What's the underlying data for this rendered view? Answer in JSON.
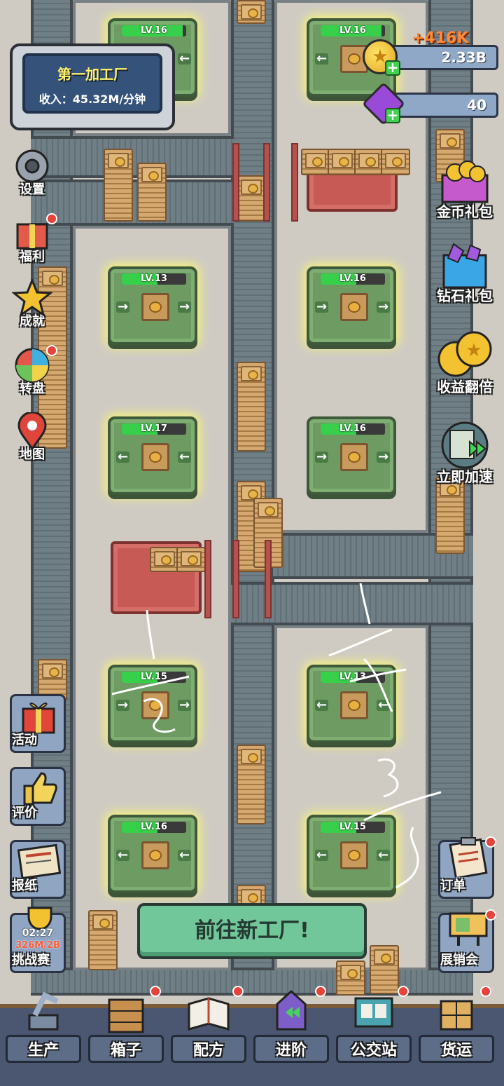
{
  "factory": {
    "name": "第一加工厂",
    "income": "收入：45.32M/分钟"
  },
  "currency": {
    "coins": "2.33B",
    "coin_gain": "+416K",
    "gems": "40"
  },
  "left_menu": [
    {
      "label": "设置",
      "icon": "gear-icon"
    },
    {
      "label": "福利",
      "icon": "gift-icon"
    },
    {
      "label": "成就",
      "icon": "star-badge-icon"
    },
    {
      "label": "转盘",
      "icon": "wheel-icon"
    },
    {
      "label": "地图",
      "icon": "map-pin-icon"
    }
  ],
  "right_menu": [
    {
      "label": "金币礼包",
      "icon": "coin-chest-icon"
    },
    {
      "label": "钻石礼包",
      "icon": "gem-chest-icon"
    },
    {
      "label": "收益翻倍",
      "icon": "coin-stack-icon"
    },
    {
      "label": "立即加速",
      "icon": "speed-up-icon"
    }
  ],
  "left_lower_menu": [
    {
      "label": "活动",
      "icon": "present-icon"
    },
    {
      "label": "评价",
      "icon": "thumbs-up-icon"
    },
    {
      "label": "报纸",
      "icon": "newspaper-icon"
    }
  ],
  "challenge": {
    "label": "挑战赛",
    "timer": "02:27",
    "progress": "326M/2B",
    "icon": "trophy-icon"
  },
  "right_lower_menu": [
    {
      "label": "订单",
      "icon": "clipboard-icon"
    },
    {
      "label": "展销会",
      "icon": "billboard-icon"
    }
  ],
  "machines": [
    {
      "level": "LV.16",
      "fill": 0.95
    },
    {
      "level": "LV.16",
      "fill": 0.95
    },
    {
      "level": "LV.13",
      "fill": 0.55
    },
    {
      "level": "LV.16",
      "fill": 0.55
    },
    {
      "level": "LV.17",
      "fill": 0.55
    },
    {
      "level": "LV.16",
      "fill": 0.55
    },
    {
      "level": "LV.15",
      "fill": 0.55
    },
    {
      "level": "LV.13",
      "fill": 0.55
    },
    {
      "level": "LV.16",
      "fill": 0.55
    },
    {
      "level": "LV.15",
      "fill": 0.55
    }
  ],
  "go_new_factory": "前往新工厂!",
  "bottom_nav": [
    {
      "label": "生产",
      "icon": "robot-arm-icon",
      "badge": false
    },
    {
      "label": "箱子",
      "icon": "crate-icon",
      "badge": true
    },
    {
      "label": "配方",
      "icon": "recipe-book-icon",
      "badge": true
    },
    {
      "label": "进阶",
      "icon": "upgrade-icon",
      "badge": true
    },
    {
      "label": "公交站",
      "icon": "bus-stop-icon",
      "badge": true
    },
    {
      "label": "货运",
      "icon": "shipping-icon",
      "badge": true
    }
  ],
  "handwritten_marks": [
    "1",
    "2",
    "3",
    "4",
    "5"
  ],
  "colors": {
    "machine_green": "#6d9b62",
    "level_fill": "#37d04a",
    "coin_gain": "#ff8a3a",
    "go_button": "#72c79a",
    "factory_title": "#fff36a"
  }
}
